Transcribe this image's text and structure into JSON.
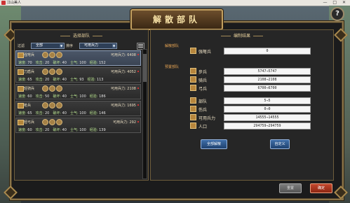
{
  "window": {
    "title": "江山美人"
  },
  "dialog": {
    "title": "解散部队",
    "help_label": "?"
  },
  "left_panel": {
    "title": "选择部队",
    "filter_label": "过滤",
    "filter_value": "全部",
    "sort_label": "排序",
    "sort_value": "可用兵力",
    "troops": [
      {
        "name": "强弩兵",
        "power_label": "可用兵力:",
        "power": "6408",
        "speed": "70",
        "attack": "20",
        "morale": "40",
        "energy": "100",
        "exp": "152"
      },
      {
        "name": "刀盾兵",
        "power_label": "可用兵力:",
        "power": "4052",
        "speed": "65",
        "attack": "20",
        "morale": "40",
        "energy": "93",
        "exp": "113"
      },
      {
        "name": "轻骑兵",
        "power_label": "可用兵力:",
        "power": "2108",
        "speed": "60",
        "attack": "50",
        "morale": "40",
        "energy": "100",
        "exp": "186"
      },
      {
        "name": "枪兵",
        "power_label": "可用兵力:",
        "power": "1695",
        "speed": "65",
        "attack": "20",
        "morale": "40",
        "energy": "100",
        "exp": "146"
      },
      {
        "name": "轻弓兵",
        "power_label": "可用兵力:",
        "power": "292",
        "speed": "60",
        "attack": "20",
        "morale": "40",
        "energy": "100",
        "exp": "139"
      }
    ],
    "stat_labels": {
      "speed": "速度:",
      "attack": "攻击:",
      "morale": "破坏:",
      "energy": "士气:",
      "exp": "经验:"
    }
  },
  "right_panel": {
    "title": "编制结果",
    "disband_section": "解散部队",
    "disband_troop": {
      "name": "强弩兵",
      "value": "0"
    },
    "reserve_section": "预置部队",
    "reserve": [
      {
        "name": "步兵",
        "value": "5747→5747"
      },
      {
        "name": "骑兵",
        "value": "2108→2108"
      },
      {
        "name": "弓兵",
        "value": "6700→6700"
      }
    ],
    "summary": [
      {
        "name": "部队",
        "value": "5→5"
      },
      {
        "name": "伤兵",
        "value": "0→0"
      },
      {
        "name": "可用兵力",
        "value": "14555→14555"
      },
      {
        "name": "人口",
        "value": "294759→294759"
      }
    ],
    "btn_all_disband": "全部解散",
    "btn_custom": "自定义"
  },
  "footer": {
    "btn_reset": "重置",
    "btn_confirm": "确定"
  }
}
